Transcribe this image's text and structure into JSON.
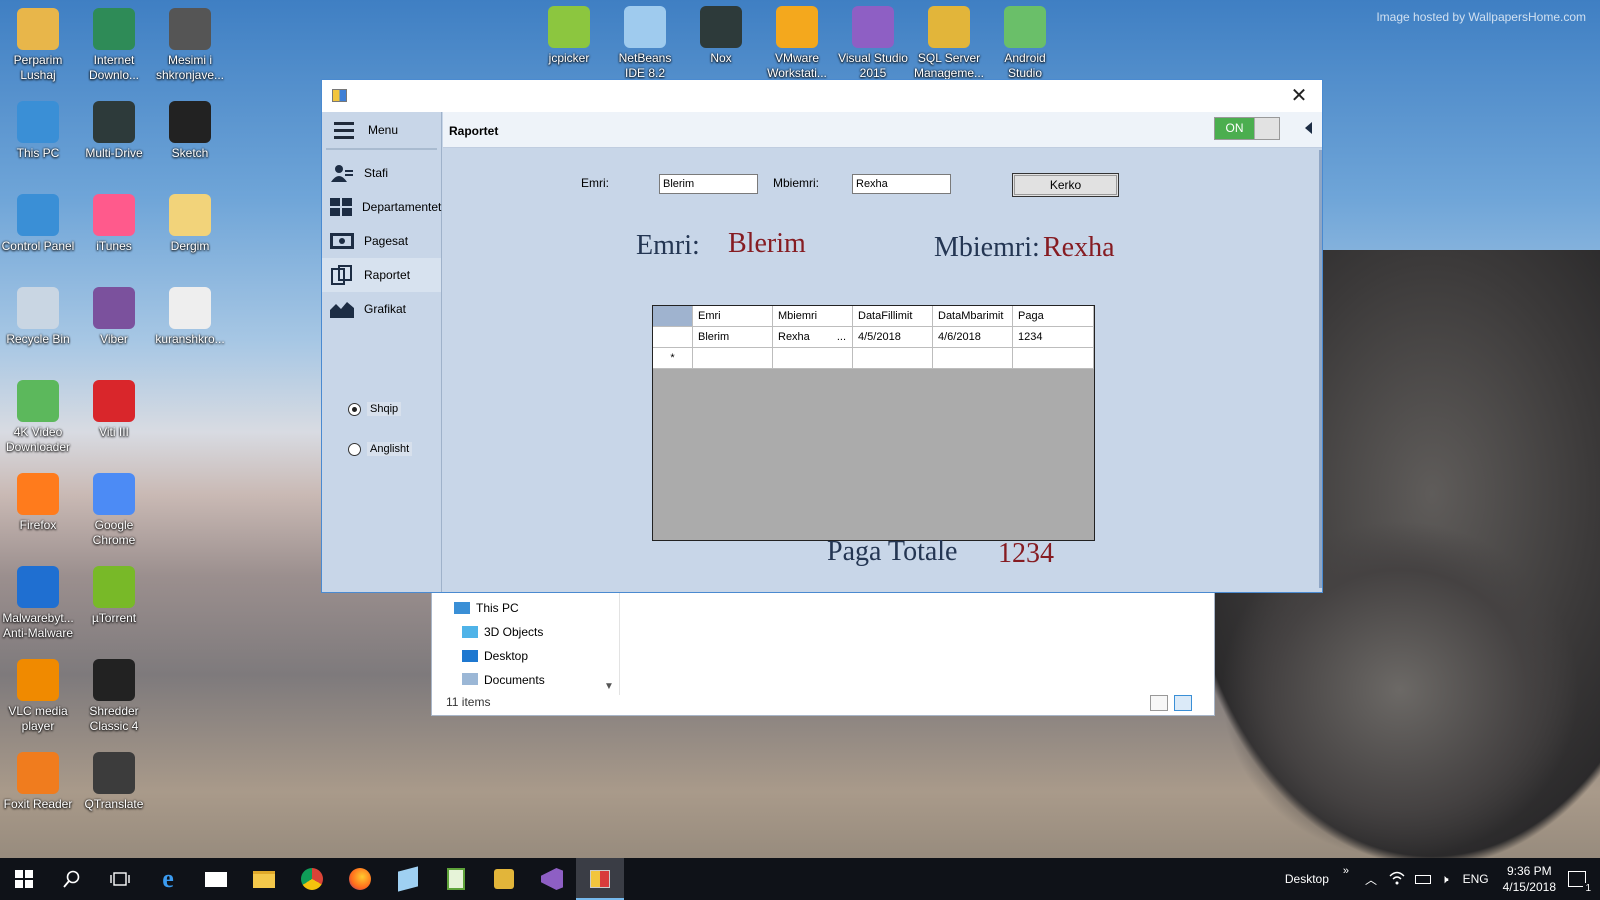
{
  "watermark": "Image hosted by WallpapersHome.com",
  "desktop": {
    "icons": [
      {
        "label": "Perparim Lushaj",
        "icon": "user-folder-icon",
        "color": "#e8b64a"
      },
      {
        "label": "Internet Downlo...",
        "icon": "internet-download-manager-icon",
        "color": "#2e8b57"
      },
      {
        "label": "Mesimi i shkronjave...",
        "icon": "image-file-icon",
        "color": "#555555"
      },
      {
        "label": "This PC",
        "icon": "this-pc-icon",
        "color": "#3a8fd6"
      },
      {
        "label": "Multi-Drive",
        "icon": "nox-icon",
        "color": "#2d3a3a"
      },
      {
        "label": "Sketch",
        "icon": "sketch-icon",
        "color": "#222222"
      },
      {
        "label": "Control Panel",
        "icon": "control-panel-icon",
        "color": "#3a8fd6"
      },
      {
        "label": "iTunes",
        "icon": "itunes-icon",
        "color": "#ff5a8c"
      },
      {
        "label": "Dergim",
        "icon": "folder-icon",
        "color": "#f2d37a"
      },
      {
        "label": "Recycle Bin",
        "icon": "recycle-bin-icon",
        "color": "#c9d6e3"
      },
      {
        "label": "Viber",
        "icon": "viber-icon",
        "color": "#7b519d"
      },
      {
        "label": "kuranshkro...",
        "icon": "document-icon",
        "color": "#eeeeee"
      },
      {
        "label": "4K Video Downloader",
        "icon": "4k-video-downloader-icon",
        "color": "#5cb85c"
      },
      {
        "label": "Viti III",
        "icon": "red-folder-icon",
        "color": "#d9262b"
      },
      {
        "label": "Firefox",
        "icon": "firefox-icon",
        "color": "#ff7b1c"
      },
      {
        "label": "Google Chrome",
        "icon": "chrome-icon",
        "color": "#4c8bf5"
      },
      {
        "label": "Malwarebyt... Anti-Malware",
        "icon": "malwarebytes-icon",
        "color": "#1f6fd1"
      },
      {
        "label": "µTorrent",
        "icon": "utorrent-icon",
        "color": "#78b928"
      },
      {
        "label": "VLC media player",
        "icon": "vlc-icon",
        "color": "#f08a00"
      },
      {
        "label": "Shredder Classic 4",
        "icon": "shredder-chess-icon",
        "color": "#222222"
      },
      {
        "label": "Foxit Reader",
        "icon": "foxit-reader-icon",
        "color": "#f07c1e"
      },
      {
        "label": "QTranslate",
        "icon": "qtranslate-icon",
        "color": "#3c3c3c"
      }
    ],
    "top_icons": [
      {
        "label": "jcpicker",
        "icon": "jcpicker-icon",
        "color": "#8cc63f"
      },
      {
        "label": "NetBeans IDE 8.2",
        "icon": "netbeans-icon",
        "color": "#9fcbee"
      },
      {
        "label": "Nox",
        "icon": "nox-icon",
        "color": "#2d3a3a"
      },
      {
        "label": "VMware Workstati...",
        "icon": "vmware-icon",
        "color": "#f4a81d"
      },
      {
        "label": "Visual Studio 2015",
        "icon": "visual-studio-icon",
        "color": "#8e5fc4"
      },
      {
        "label": "SQL Server Manageme...",
        "icon": "sql-server-icon",
        "color": "#e2b53a"
      },
      {
        "label": "Android Studio",
        "icon": "android-studio-icon",
        "color": "#6abf69"
      }
    ]
  },
  "explorer": {
    "tree": [
      {
        "label": "This PC",
        "icon": "this-pc-icon"
      },
      {
        "label": "3D Objects",
        "icon": "3d-objects-icon"
      },
      {
        "label": "Desktop",
        "icon": "desktop-folder-icon"
      },
      {
        "label": "Documents",
        "icon": "documents-folder-icon"
      }
    ],
    "status": "11 items"
  },
  "window": {
    "title": "",
    "close_glyph": "✕",
    "menu_label": "Menu",
    "nav": [
      {
        "label": "Stafi",
        "icon": "staff-icon"
      },
      {
        "label": "Departamentet",
        "icon": "departments-icon"
      },
      {
        "label": "Pagesat",
        "icon": "payments-icon"
      },
      {
        "label": "Raportet",
        "icon": "reports-icon",
        "selected": true
      },
      {
        "label": "Grafikat",
        "icon": "charts-icon"
      }
    ],
    "languages": [
      {
        "label": "Shqip",
        "checked": true
      },
      {
        "label": "Anglisht",
        "checked": false
      }
    ],
    "header_title": "Raportet",
    "toggle_on_label": "ON",
    "search": {
      "emri_label": "Emri:",
      "emri_value": "Blerim",
      "mbiemri_label": "Mbiemri:",
      "mbiemri_value": "Rexha",
      "button_label": "Kerko"
    },
    "result": {
      "emri_label": "Emri:",
      "emri_value": "Blerim",
      "mbiemri_label": "Mbiemri:",
      "mbiemri_value": "Rexha",
      "total_label": "Paga Totale",
      "total_value": "1234"
    },
    "grid": {
      "columns": [
        "Emri",
        "Mbiemri",
        "DataFillimit",
        "DataMbarimit",
        "Paga"
      ],
      "rows": [
        [
          "Blerim",
          "Rexha",
          "4/5/2018",
          "4/6/2018",
          "1234"
        ]
      ],
      "ellipsis": "...",
      "new_row_marker": "*"
    }
  },
  "taskbar": {
    "desktop_label": "Desktop",
    "overflow": "»",
    "lang": "ENG",
    "time": "9:36 PM",
    "date": "4/15/2018",
    "notifications": "1"
  }
}
